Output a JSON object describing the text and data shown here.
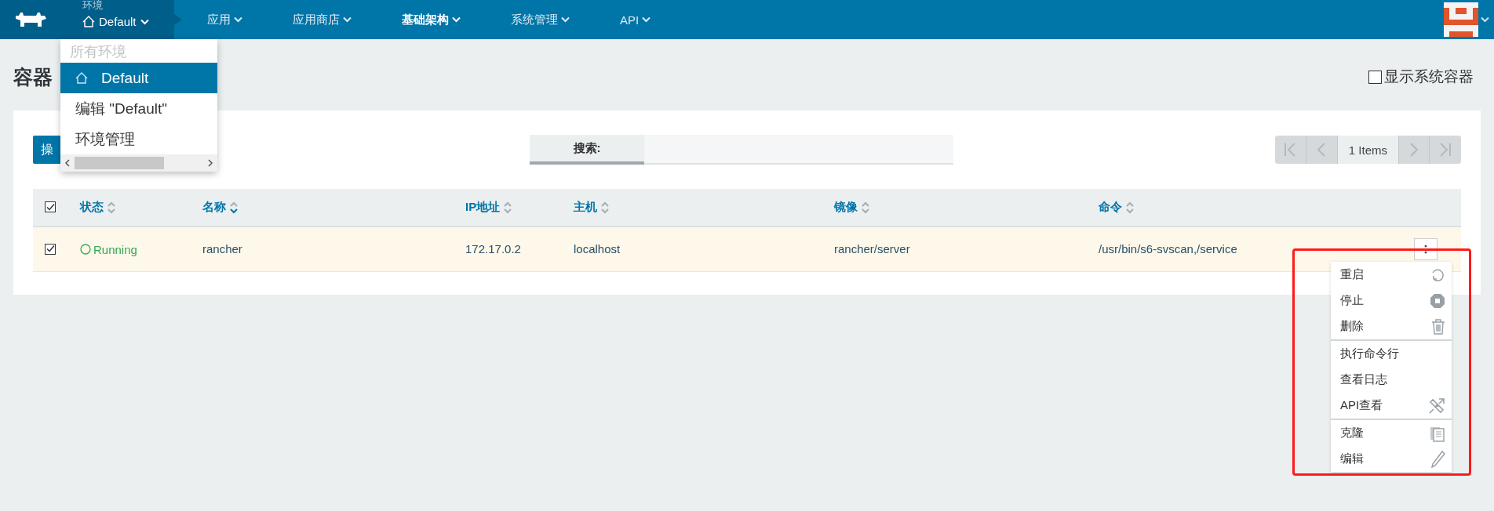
{
  "nav": {
    "env_label": "环境",
    "env_value": "Default",
    "items": [
      {
        "label": "应用",
        "selected": false
      },
      {
        "label": "应用商店",
        "selected": false
      },
      {
        "label": "基础架构",
        "selected": true
      },
      {
        "label": "系统管理",
        "selected": false
      },
      {
        "label": "API",
        "selected": false
      }
    ]
  },
  "env_menu": {
    "header": "所有环境",
    "items": [
      {
        "label": "Default",
        "selected": true,
        "kind": "environment"
      },
      {
        "label": "编辑 \"Default\"",
        "selected": false,
        "kind": "action"
      },
      {
        "label": "环境管理",
        "selected": false,
        "kind": "action"
      }
    ]
  },
  "page_title": "容器",
  "show_system": {
    "label": "显示系统容器",
    "checked": false
  },
  "action_button": "操",
  "search": {
    "label": "搜索:"
  },
  "pager": {
    "text": "1 Items"
  },
  "table": {
    "all_checked": true,
    "columns": [
      {
        "label": "状态",
        "sorted": false
      },
      {
        "label": "名称",
        "sorted": true
      },
      {
        "label": "IP地址",
        "sorted": false
      },
      {
        "label": "主机",
        "sorted": false
      },
      {
        "label": "镜像",
        "sorted": false
      },
      {
        "label": "命令",
        "sorted": false
      }
    ],
    "rows": [
      {
        "checked": true,
        "selected": true,
        "status": "Running",
        "name": "rancher",
        "ip": "172.17.0.2",
        "host": "localhost",
        "image": "rancher/server",
        "command": "/usr/bin/s6-svscan,/service"
      }
    ]
  },
  "context_menu": [
    [
      "重启",
      "停止",
      "删除"
    ],
    [
      "执行命令行",
      "查看日志",
      "API查看"
    ],
    [
      "克隆",
      "编辑"
    ]
  ]
}
